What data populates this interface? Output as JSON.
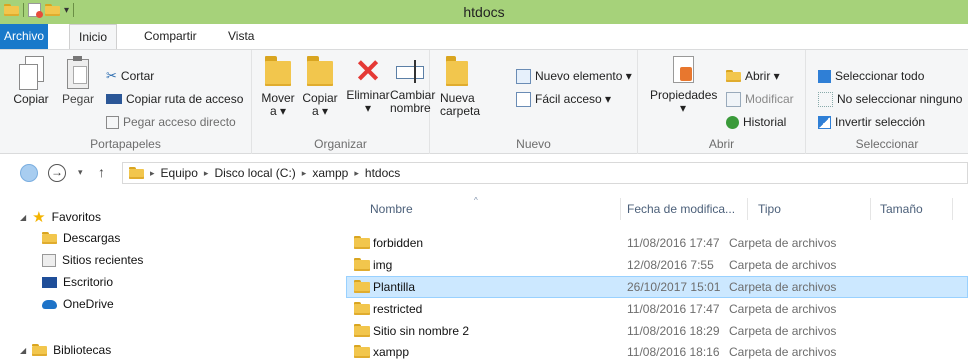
{
  "window": {
    "title": "htdocs"
  },
  "ribbon_tabs": [
    {
      "label": "Archivo"
    },
    {
      "label": "Inicio"
    },
    {
      "label": "Compartir"
    },
    {
      "label": "Vista"
    }
  ],
  "ribbon": {
    "portapapeles": {
      "label": "Portapapeles",
      "copiar": "Copiar",
      "pegar": "Pegar",
      "cortar": "Cortar",
      "copiar_ruta": "Copiar ruta de acceso",
      "pegar_acceso": "Pegar acceso directo"
    },
    "organizar": {
      "label": "Organizar",
      "mover_1": "Mover",
      "mover_2": "a ▾",
      "copiar_1": "Copiar",
      "copiar_2": "a ▾",
      "eliminar_1": "Eliminar",
      "eliminar_2": "▾",
      "cambiar_1": "Cambiar",
      "cambiar_2": "nombre"
    },
    "nuevo": {
      "label": "Nuevo",
      "carpeta_1": "Nueva",
      "carpeta_2": "carpeta",
      "elemento": "Nuevo elemento ▾",
      "facil": "Fácil acceso ▾"
    },
    "abrir": {
      "label": "Abrir",
      "propiedades_1": "Propiedades",
      "propiedades_2": "▾",
      "abrir": "Abrir ▾",
      "modificar": "Modificar",
      "historial": "Historial"
    },
    "seleccionar": {
      "label": "Seleccionar",
      "todo": "Seleccionar todo",
      "ninguno": "No seleccionar ninguno",
      "invertir": "Invertir selección"
    }
  },
  "address": {
    "arrow_down": "▾",
    "arrow_up": "↑",
    "sep": "▸",
    "crumbs": [
      {
        "label": "Equipo"
      },
      {
        "label": "Disco local (C:)"
      },
      {
        "label": "xampp"
      },
      {
        "label": "htdocs"
      }
    ]
  },
  "nav": {
    "favoritos": "Favoritos",
    "descargas": "Descargas",
    "sitios": "Sitios recientes",
    "escritorio": "Escritorio",
    "onedrive": "OneDrive",
    "bibliotecas": "Bibliotecas"
  },
  "columns": {
    "nombre": "Nombre",
    "fecha": "Fecha de modifica...",
    "tipo": "Tipo",
    "tamano": "Tamaño"
  },
  "files": [
    {
      "name": "forbidden",
      "date": "11/08/2016 17:47",
      "type": "Carpeta de archivos"
    },
    {
      "name": "img",
      "date": "12/08/2016 7:55",
      "type": "Carpeta de archivos"
    },
    {
      "name": "Plantilla",
      "date": "26/10/2017 15:01",
      "type": "Carpeta de archivos",
      "selected": true
    },
    {
      "name": "restricted",
      "date": "11/08/2016 17:47",
      "type": "Carpeta de archivos"
    },
    {
      "name": "Sitio sin nombre 2",
      "date": "11/08/2016 18:29",
      "type": "Carpeta de archivos"
    },
    {
      "name": "xampp",
      "date": "11/08/2016 18:16",
      "type": "Carpeta de archivos"
    }
  ],
  "colors": {
    "titlebar": "#a6d27a",
    "archivo_tab": "#1979ca",
    "selection": "#cce8ff"
  }
}
